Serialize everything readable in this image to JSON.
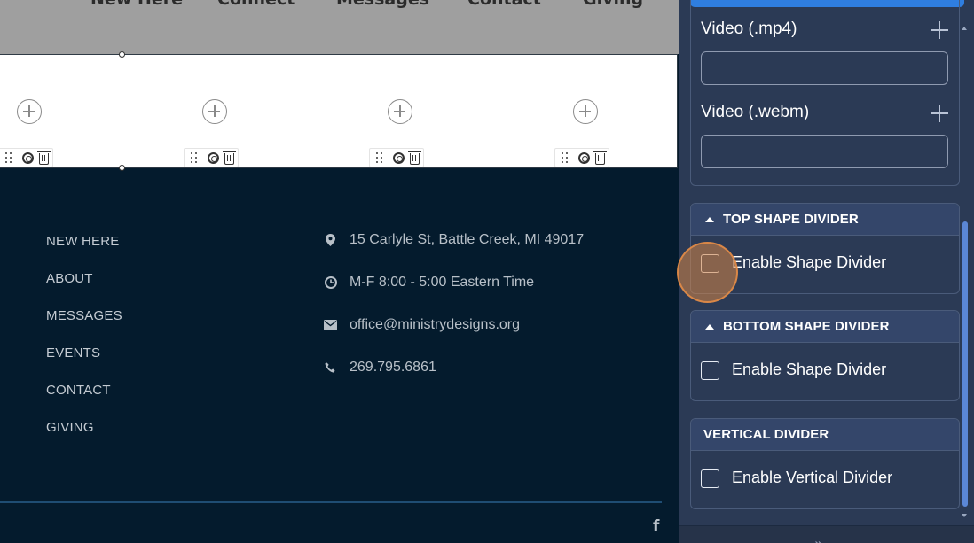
{
  "nav": {
    "items": [
      "New Here",
      "Connect",
      "Messages",
      "Contact",
      "Giving"
    ]
  },
  "footer": {
    "links": [
      "NEW HERE",
      "ABOUT",
      "MESSAGES",
      "EVENTS",
      "CONTACT",
      "GIVING"
    ],
    "contact": {
      "address": "15 Carlyle St, Battle Creek, MI 49017",
      "hours": "M-F 8:00 - 5:00 Eastern Time",
      "email": "office@ministrydesigns.org",
      "phone": "269.795.6861"
    },
    "social_icon": "f"
  },
  "panel": {
    "video_mp4_label": "Video (.mp4)",
    "video_webm_label": "Video (.webm)",
    "video_mp4_value": "",
    "video_webm_value": "",
    "top_divider": {
      "title": "TOP SHAPE DIVIDER",
      "checkbox_label": "Enable Shape Divider",
      "checked": false
    },
    "bottom_divider": {
      "title": "BOTTOM SHAPE DIVIDER",
      "checkbox_label": "Enable Shape Divider",
      "checked": false
    },
    "vertical_divider": {
      "title": "VERTICAL DIVIDER",
      "checkbox_label": "Enable Vertical Divider",
      "checked": false
    },
    "collapse_glyph": "»"
  },
  "colors": {
    "footer_bg": "#041b2d",
    "nav_bg": "#9f9f9f",
    "panel_bg": "#2b3a55",
    "accent_blue": "#2f7ee0",
    "click_highlight": "#d68546"
  }
}
